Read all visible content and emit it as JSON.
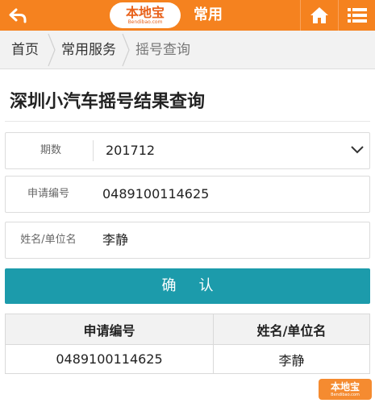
{
  "header": {
    "logo_text": "本地宝",
    "logo_sub": "Bendibao.com",
    "title": "常用"
  },
  "breadcrumb": [
    "首页",
    "常用服务",
    "摇号查询"
  ],
  "page_title": "深圳小汽车摇号结果查询",
  "form": {
    "period_label": "期数",
    "period_value": "201712",
    "app_no_label": "申请编号",
    "app_no_value": "0489100114625",
    "name_label": "姓名/单位名",
    "name_value": "李静"
  },
  "confirm_label": "确认",
  "results": {
    "headers": [
      "申请编号",
      "姓名/单位名"
    ],
    "rows": [
      [
        "0489100114625",
        "李静"
      ]
    ]
  },
  "watermark": {
    "text": "本地宝",
    "sub": "Bendibao.com"
  },
  "colors": {
    "header_orange": "#f5821f",
    "confirm_teal": "#1c9bab"
  },
  "icons": [
    "back-arrow-icon",
    "home-icon",
    "menu-list-icon",
    "chevron-down-icon"
  ]
}
